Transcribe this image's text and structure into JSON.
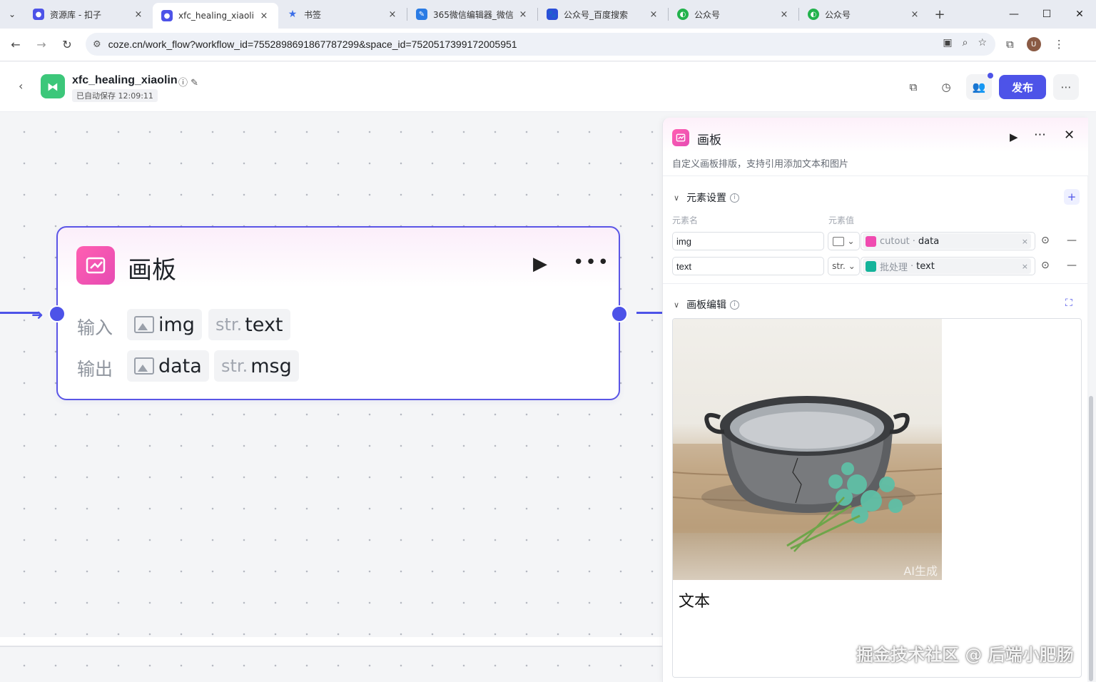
{
  "browser": {
    "tabs": [
      {
        "title": "资源库 - 扣子",
        "color": "#4d53e8",
        "active": false
      },
      {
        "title": "xfc_healing_xiaolin",
        "color": "#4d53e8",
        "active": true
      },
      {
        "title": "书签",
        "color": "#3b6ee8",
        "active": false
      },
      {
        "title": "365微信编辑器_微信",
        "color": "#2a7be4",
        "active": false
      },
      {
        "title": "公众号_百度搜索",
        "color": "#2b4fd8",
        "active": false
      },
      {
        "title": "公众号",
        "color": "#22b24c",
        "active": false
      },
      {
        "title": "公众号",
        "color": "#22b24c",
        "active": false
      }
    ],
    "url": "coze.cn/work_flow?workflow_id=7552898691867787299&space_id=7520517399172005951",
    "profile_initial": "U"
  },
  "app": {
    "name": "xfc_healing_xiaolin",
    "saved_status": "已自动保存 12:09:11",
    "publish_label": "发布",
    "brand_color": "#4d53e8"
  },
  "node": {
    "title": "画板",
    "input_label": "输入",
    "output_label": "输出",
    "inputs": [
      {
        "type": "image",
        "type_label": "",
        "name": "img"
      },
      {
        "type": "string",
        "type_label": "str.",
        "name": "text"
      }
    ],
    "outputs": [
      {
        "type": "image",
        "type_label": "",
        "name": "data"
      },
      {
        "type": "string",
        "type_label": "str.",
        "name": "msg"
      }
    ]
  },
  "panel": {
    "title": "画板",
    "description": "自定义画板排版，支持引用添加文本和图片",
    "elements_section": "元素设置",
    "col_name": "元素名",
    "col_value": "元素值",
    "elements": [
      {
        "name": "img",
        "type_label": "",
        "type": "image",
        "ref_node": "cutout",
        "ref_var": "data",
        "chip_color": "#f04bb0"
      },
      {
        "name": "text",
        "type_label": "str.",
        "type": "string",
        "ref_node": "批处理",
        "ref_var": "text",
        "chip_color": "#14b39a"
      }
    ],
    "editor_section": "画板编辑",
    "artboard_text": "文本",
    "ai_tag": "AI生成"
  },
  "watermark": "掘金技术社区 @ 后端小肥肠"
}
